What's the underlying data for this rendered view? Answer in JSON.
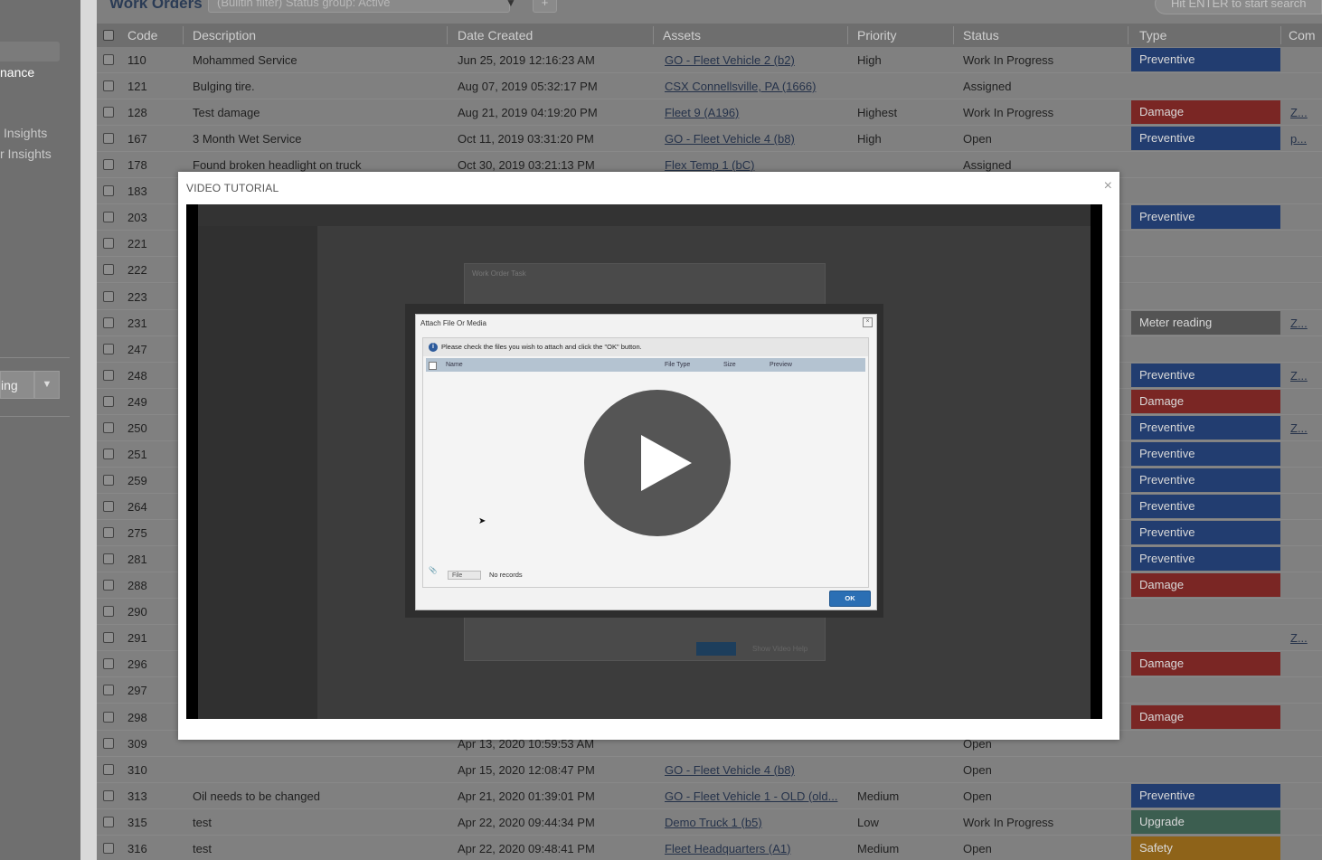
{
  "sidebar": {
    "items": [
      {
        "label": "nance"
      },
      {
        "label": "Insights"
      },
      {
        "label": "r Insights"
      }
    ],
    "button_label": "ing"
  },
  "header": {
    "title": "Work Orders",
    "filter_value": "(Builtin filter) Status group: Active",
    "add_label": "+",
    "search_placeholder": "Hit ENTER to start search"
  },
  "table": {
    "columns": [
      "Code",
      "Description",
      "Date Created",
      "Assets",
      "Priority",
      "Status",
      "Type",
      "Com"
    ],
    "rows": [
      {
        "code": "110",
        "description": "Mohammed Service",
        "date": "Jun 25, 2019 12:16:23 AM",
        "asset": "GO - Fleet Vehicle 2 (b2)",
        "priority": "High",
        "status": "Work In Progress",
        "type": "Preventive",
        "comment": ""
      },
      {
        "code": "121",
        "description": "Bulging tire.",
        "date": "Aug 07, 2019 05:32:17 PM",
        "asset": "CSX Connellsville, PA (1666)",
        "priority": "",
        "status": "Assigned",
        "type": "",
        "comment": ""
      },
      {
        "code": "128",
        "description": "Test damage",
        "date": "Aug 21, 2019 04:19:20 PM",
        "asset": "Fleet 9 (A196)",
        "priority": "Highest",
        "status": "Work In Progress",
        "type": "Damage",
        "comment": "Z..."
      },
      {
        "code": "167",
        "description": "3 Month Wet Service",
        "date": "Oct 11, 2019 03:31:20 PM",
        "asset": "GO - Fleet Vehicle 4 (b8)",
        "priority": "High",
        "status": "Open",
        "type": "Preventive",
        "comment": "p..."
      },
      {
        "code": "178",
        "description": "Found broken headlight on truck",
        "date": "Oct 30, 2019 03:21:13 PM",
        "asset": "Flex Temp 1 (bC)",
        "priority": "",
        "status": "Assigned",
        "type": "",
        "comment": ""
      },
      {
        "code": "183",
        "description": "",
        "date": "",
        "asset": "",
        "priority": "",
        "status": "",
        "type": "",
        "comment": ""
      },
      {
        "code": "203",
        "description": "",
        "date": "",
        "asset": "",
        "priority": "",
        "status": "",
        "type": "Preventive",
        "comment": ""
      },
      {
        "code": "221",
        "description": "",
        "date": "",
        "asset": "",
        "priority": "",
        "status": "",
        "type": "",
        "comment": ""
      },
      {
        "code": "222",
        "description": "",
        "date": "",
        "asset": "",
        "priority": "",
        "status": "",
        "type": "",
        "comment": ""
      },
      {
        "code": "223",
        "description": "",
        "date": "",
        "asset": "",
        "priority": "",
        "status": "",
        "type": "",
        "comment": ""
      },
      {
        "code": "231",
        "description": "",
        "date": "",
        "asset": "",
        "priority": "",
        "status": "",
        "type": "Meter reading",
        "comment": "Z..."
      },
      {
        "code": "247",
        "description": "",
        "date": "",
        "asset": "",
        "priority": "",
        "status": "",
        "type": "",
        "comment": ""
      },
      {
        "code": "248",
        "description": "",
        "date": "",
        "asset": "",
        "priority": "",
        "status": "",
        "type": "Preventive",
        "comment": "Z..."
      },
      {
        "code": "249",
        "description": "",
        "date": "",
        "asset": "",
        "priority": "",
        "status": "",
        "type": "Damage",
        "comment": ""
      },
      {
        "code": "250",
        "description": "",
        "date": "",
        "asset": "",
        "priority": "",
        "status": "",
        "type": "Preventive",
        "comment": "Z..."
      },
      {
        "code": "251",
        "description": "",
        "date": "",
        "asset": "",
        "priority": "",
        "status": "",
        "type": "Preventive",
        "comment": ""
      },
      {
        "code": "259",
        "description": "",
        "date": "",
        "asset": "",
        "priority": "",
        "status": "",
        "type": "Preventive",
        "comment": ""
      },
      {
        "code": "264",
        "description": "",
        "date": "",
        "asset": "",
        "priority": "",
        "status": "",
        "type": "Preventive",
        "comment": ""
      },
      {
        "code": "275",
        "description": "",
        "date": "",
        "asset": "",
        "priority": "",
        "status": "",
        "type": "Preventive",
        "comment": ""
      },
      {
        "code": "281",
        "description": "",
        "date": "",
        "asset": "",
        "priority": "",
        "status": "",
        "type": "Preventive",
        "comment": ""
      },
      {
        "code": "288",
        "description": "",
        "date": "",
        "asset": "",
        "priority": "",
        "status": "",
        "type": "Damage",
        "comment": ""
      },
      {
        "code": "290",
        "description": "",
        "date": "",
        "asset": "",
        "priority": "",
        "status": "",
        "type": "",
        "comment": ""
      },
      {
        "code": "291",
        "description": "",
        "date": "",
        "asset": "",
        "priority": "",
        "status": "",
        "type": "",
        "comment": "Z..."
      },
      {
        "code": "296",
        "description": "",
        "date": "",
        "asset": "",
        "priority": "",
        "status": "",
        "type": "Damage",
        "comment": ""
      },
      {
        "code": "297",
        "description": "",
        "date": "",
        "asset": "",
        "priority": "",
        "status": "",
        "type": "",
        "comment": ""
      },
      {
        "code": "298",
        "description": "",
        "date": "",
        "asset": "",
        "priority": "",
        "status": "",
        "type": "Damage",
        "comment": ""
      },
      {
        "code": "309",
        "description": "",
        "date": "Apr 13, 2020 10:59:53 AM",
        "asset": "",
        "priority": "",
        "status": "Open",
        "type": "",
        "comment": ""
      },
      {
        "code": "310",
        "description": "",
        "date": "Apr 15, 2020 12:08:47 PM",
        "asset": "GO - Fleet Vehicle 4 (b8)",
        "priority": "",
        "status": "Open",
        "type": "",
        "comment": ""
      },
      {
        "code": "313",
        "description": "Oil needs to be changed",
        "date": "Apr 21, 2020 01:39:01 PM",
        "asset": "GO - Fleet Vehicle 1 - OLD (old...",
        "priority": "Medium",
        "status": "Open",
        "type": "Preventive",
        "comment": ""
      },
      {
        "code": "315",
        "description": "test",
        "date": "Apr 22, 2020 09:44:34 PM",
        "asset": "Demo Truck 1 (b5)",
        "priority": "Low",
        "status": "Work In Progress",
        "type": "Upgrade",
        "comment": ""
      },
      {
        "code": "316",
        "description": "test",
        "date": "Apr 22, 2020 09:48:41 PM",
        "asset": "Fleet Headquarters (A1)",
        "priority": "Medium",
        "status": "Open",
        "type": "Safety",
        "comment": ""
      }
    ]
  },
  "type_classes": {
    "Preventive": "preventive",
    "Damage": "damage",
    "Meter reading": "meter",
    "Upgrade": "upgrade",
    "Safety": "safety"
  },
  "colors": {
    "preventive": "#223d70",
    "damage": "#7a2624",
    "meter_reading": "#545454",
    "upgrade": "#3c5e50",
    "safety": "#8e6319",
    "link": "#25324a"
  },
  "modal": {
    "title": "VIDEO TUTORIAL",
    "close_icon": "close-icon",
    "video": {
      "play_icon": "play-icon",
      "dialog": {
        "title": "Attach File Or Media",
        "message": "Please check the files you wish to attach and click the \"OK\" button.",
        "columns": [
          "Name",
          "File Type",
          "Size",
          "Preview"
        ],
        "file_button": "File",
        "empty_text": "No records",
        "ok_label": "OK"
      },
      "background_dialog": {
        "title": "Work Order Task",
        "ok_label": "OK",
        "secondary_label": "Show Video Help"
      }
    }
  }
}
